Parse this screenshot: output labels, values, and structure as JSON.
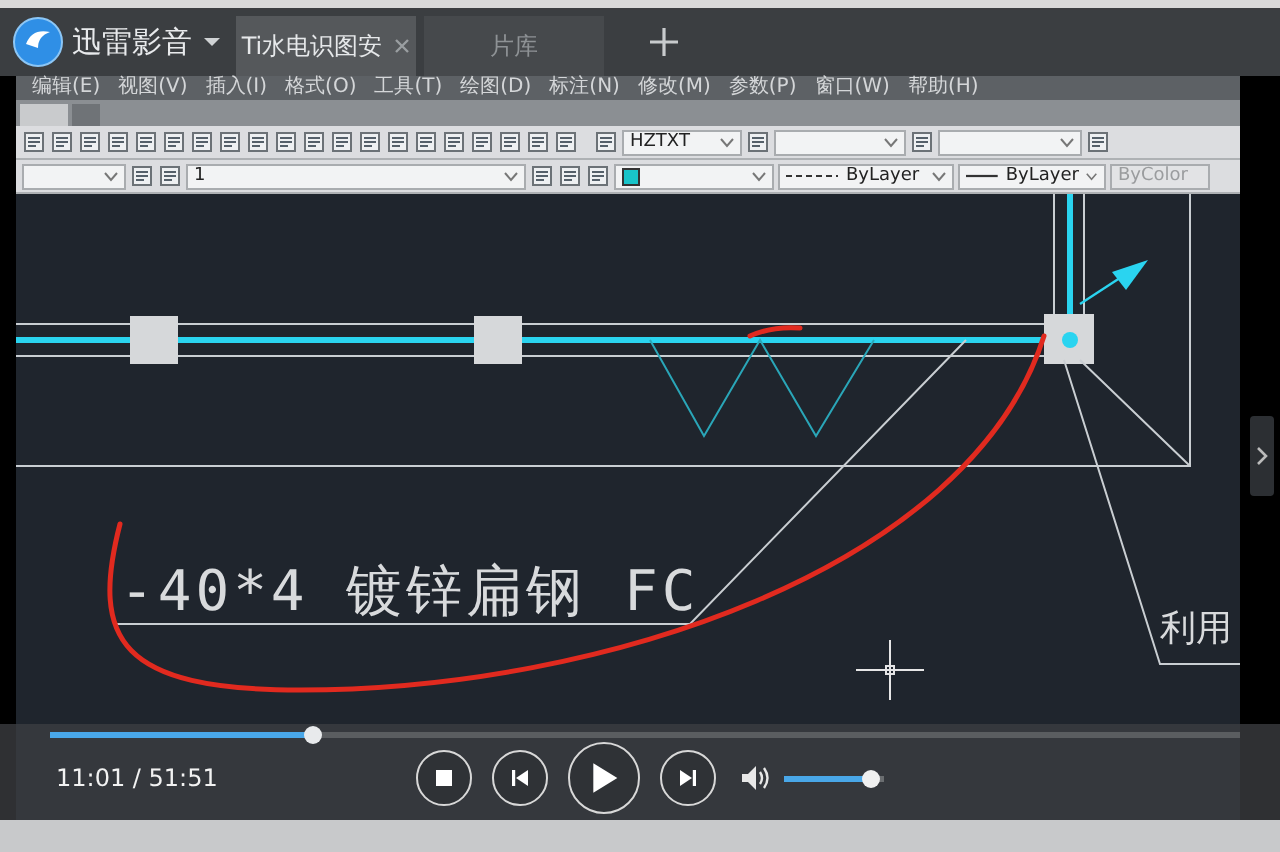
{
  "player": {
    "app_name": "迅雷影音",
    "tabs": [
      {
        "label": "Ti水电识图安",
        "selected": true
      },
      {
        "label": "片库",
        "selected": false
      }
    ]
  },
  "cad": {
    "menu": [
      "编辑(E)",
      "视图(V)",
      "插入(I)",
      "格式(O)",
      "工具(T)",
      "绘图(D)",
      "标注(N)",
      "修改(M)",
      "参数(P)",
      "窗口(W)",
      "帮助(H)"
    ],
    "layer": "1",
    "text_style": "HZTXT",
    "linetype": "ByLayer",
    "lineweight": "ByLayer",
    "plot_style": "ByColor",
    "drawing_texts": [
      "-40*4 镀锌扁钢 FC",
      "利用"
    ]
  },
  "playback": {
    "time": "11:01 / 51:51",
    "playing": false,
    "progress": {
      "level": 0.22
    },
    "volume": {
      "level": 0.85
    }
  }
}
